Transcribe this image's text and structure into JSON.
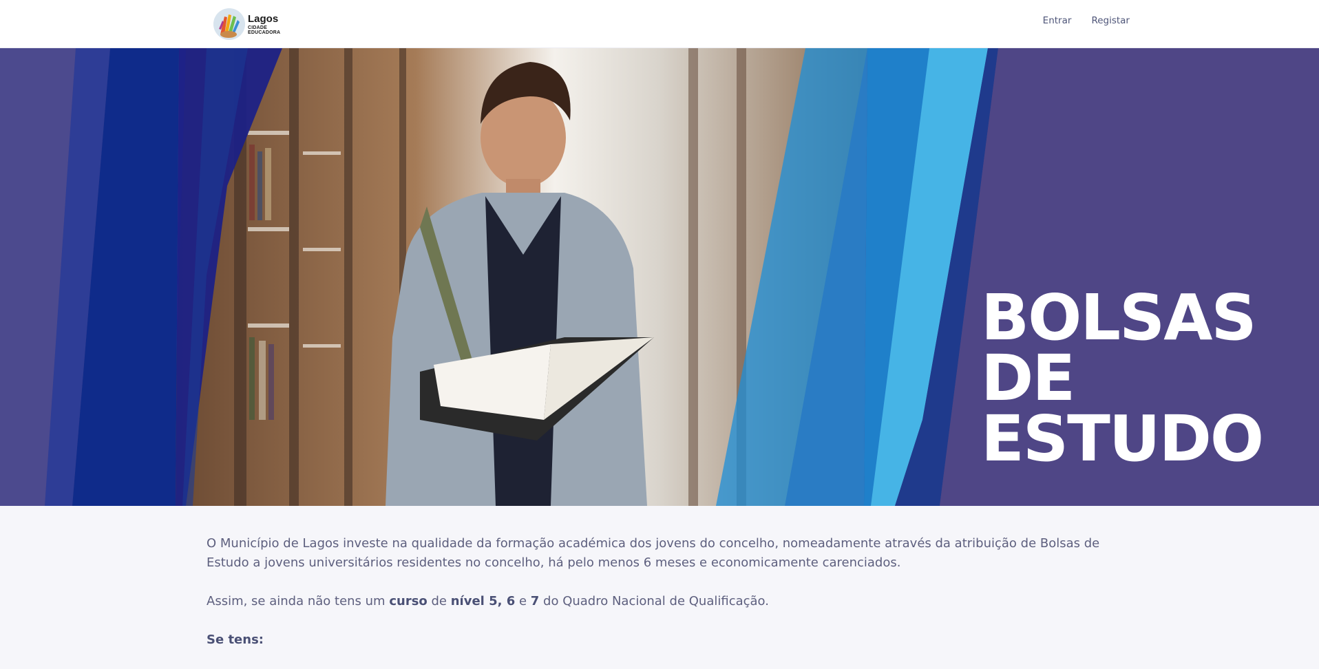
{
  "header": {
    "logo_name": "Lagos",
    "logo_sub_1": "CIDADE",
    "logo_sub_2": "EDUCADORA",
    "nav": [
      {
        "label": "Entrar"
      },
      {
        "label": "Registar"
      }
    ]
  },
  "hero": {
    "title_lines": [
      "BOLSAS",
      "DE",
      "ESTUDO"
    ]
  },
  "content": {
    "intro": "O Município de Lagos investe na qualidade da formação académica dos jovens do concelho, nomeadamente através da atribuição de Bolsas de Estudo a jovens universitários residentes no concelho, há pelo menos 6 meses e economicamente carenciados.",
    "line2_pre": "Assim, se ainda não tens um ",
    "line2_b1": "curso",
    "line2_mid1": " de ",
    "line2_b2": "nível 5, 6",
    "line2_mid2": " e ",
    "line2_b3": "7",
    "line2_post": " do Quadro Nacional de Qualificação.",
    "subhead": "Se tens:"
  },
  "colors": {
    "hero_purple": "#4f4686",
    "navy": "#1d3a8a",
    "sky": "#3aa6dd"
  }
}
